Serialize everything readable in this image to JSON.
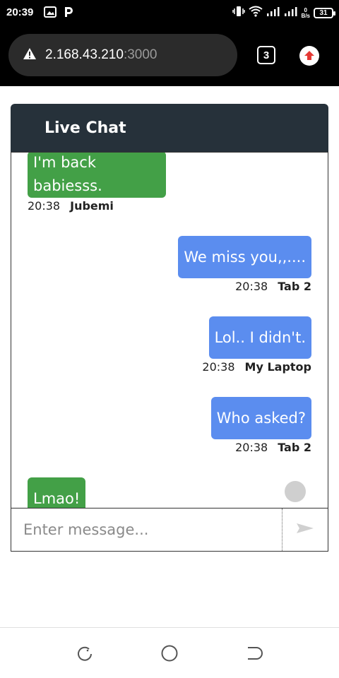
{
  "status_bar": {
    "time": "20:39",
    "net_speed_value": "0",
    "net_speed_unit": "B/s",
    "battery": "31",
    "icons": [
      "image-icon",
      "p-icon",
      "vibrate-icon",
      "wifi-icon",
      "signal-icon",
      "signal-icon"
    ]
  },
  "browser": {
    "url_host": "2.168.43.210",
    "url_port": ":3000",
    "tab_count": "3",
    "icons": [
      "warning-icon",
      "upload-icon"
    ]
  },
  "chat": {
    "title": "Live Chat",
    "messages": [
      {
        "text": "I'm back babiesss.",
        "time": "20:38",
        "author": "Jubemi",
        "side": "received"
      },
      {
        "text": "We miss you,,....",
        "time": "20:38",
        "author": "Tab 2",
        "side": "sent"
      },
      {
        "text": "Lol.. I didn't.",
        "time": "20:38",
        "author": "My Laptop",
        "side": "sent"
      },
      {
        "text": "Who asked?",
        "time": "20:38",
        "author": "Tab 2",
        "side": "sent"
      },
      {
        "text": "Lmao!",
        "side": "received"
      }
    ],
    "input_placeholder": "Enter message...",
    "colors": {
      "header": "#26313a",
      "received": "#43a047",
      "sent": "#5b8def"
    }
  },
  "nav": {
    "icons": [
      "recent-apps-icon",
      "home-icon",
      "back-icon"
    ]
  }
}
